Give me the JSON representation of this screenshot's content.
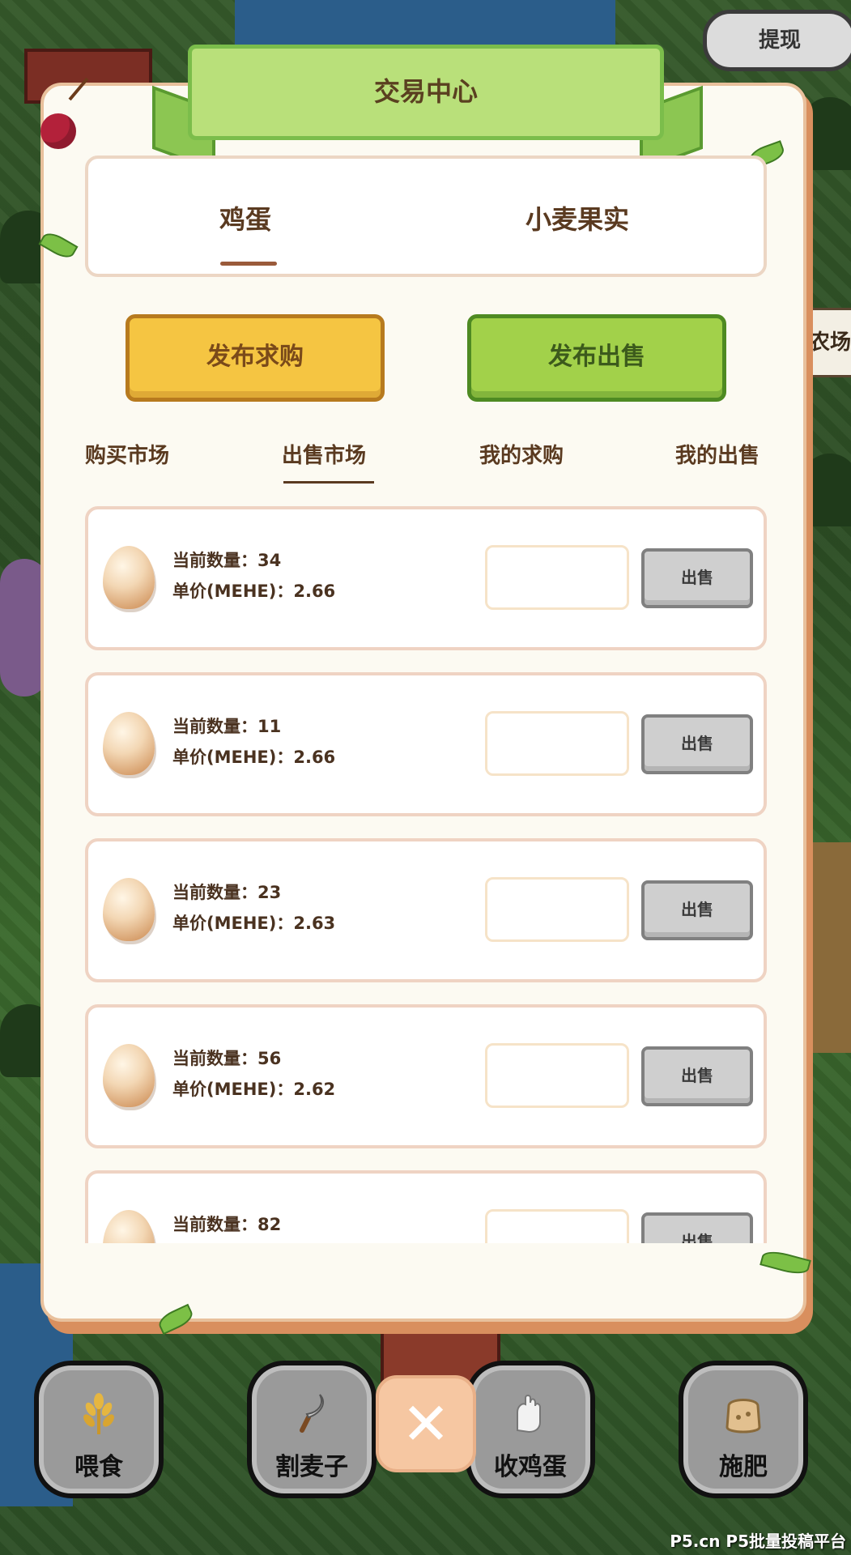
{
  "header": {
    "withdraw_label": "提现",
    "side_sign": "农场"
  },
  "panel": {
    "title": "交易中心",
    "commodity_tabs": [
      {
        "label": "鸡蛋",
        "active": true
      },
      {
        "label": "小麦果实",
        "active": false
      }
    ],
    "post_buy_label": "发布求购",
    "post_sell_label": "发布出售",
    "market_tabs": [
      {
        "label": "购买市场",
        "active": false
      },
      {
        "label": "出售市场",
        "active": true
      },
      {
        "label": "我的求购",
        "active": false
      },
      {
        "label": "我的出售",
        "active": false
      }
    ],
    "listings": [
      {
        "icon": "egg-icon",
        "quantity_text": "当前数量：34",
        "price_text": "单价(MEHE)：2.66",
        "input_value": "",
        "sell_label": "出售"
      },
      {
        "icon": "egg-icon",
        "quantity_text": "当前数量：11",
        "price_text": "单价(MEHE)：2.66",
        "input_value": "",
        "sell_label": "出售"
      },
      {
        "icon": "egg-icon",
        "quantity_text": "当前数量：23",
        "price_text": "单价(MEHE)：2.63",
        "input_value": "",
        "sell_label": "出售"
      },
      {
        "icon": "egg-icon",
        "quantity_text": "当前数量：56",
        "price_text": "单价(MEHE)：2.62",
        "input_value": "",
        "sell_label": "出售"
      },
      {
        "icon": "egg-icon",
        "quantity_text": "当前数量：82",
        "price_text": "",
        "input_value": "",
        "sell_label": "出售"
      }
    ]
  },
  "toolbar": {
    "items": [
      {
        "label": "喂食",
        "icon": "wheat-feed-icon"
      },
      {
        "label": "割麦子",
        "icon": "sickle-icon"
      },
      {
        "label": "收鸡蛋",
        "icon": "glove-icon"
      },
      {
        "label": "施肥",
        "icon": "fertilizer-sack-icon"
      }
    ],
    "close_icon": "close-icon"
  },
  "watermark": "P5.cn P5批量投稿平台",
  "colors": {
    "panel_bg": "#fcfaf2",
    "banner_green": "#b9e07a",
    "buy_yellow": "#f5c542",
    "sell_green": "#a2d14a",
    "text_brown": "#5a3a20"
  }
}
